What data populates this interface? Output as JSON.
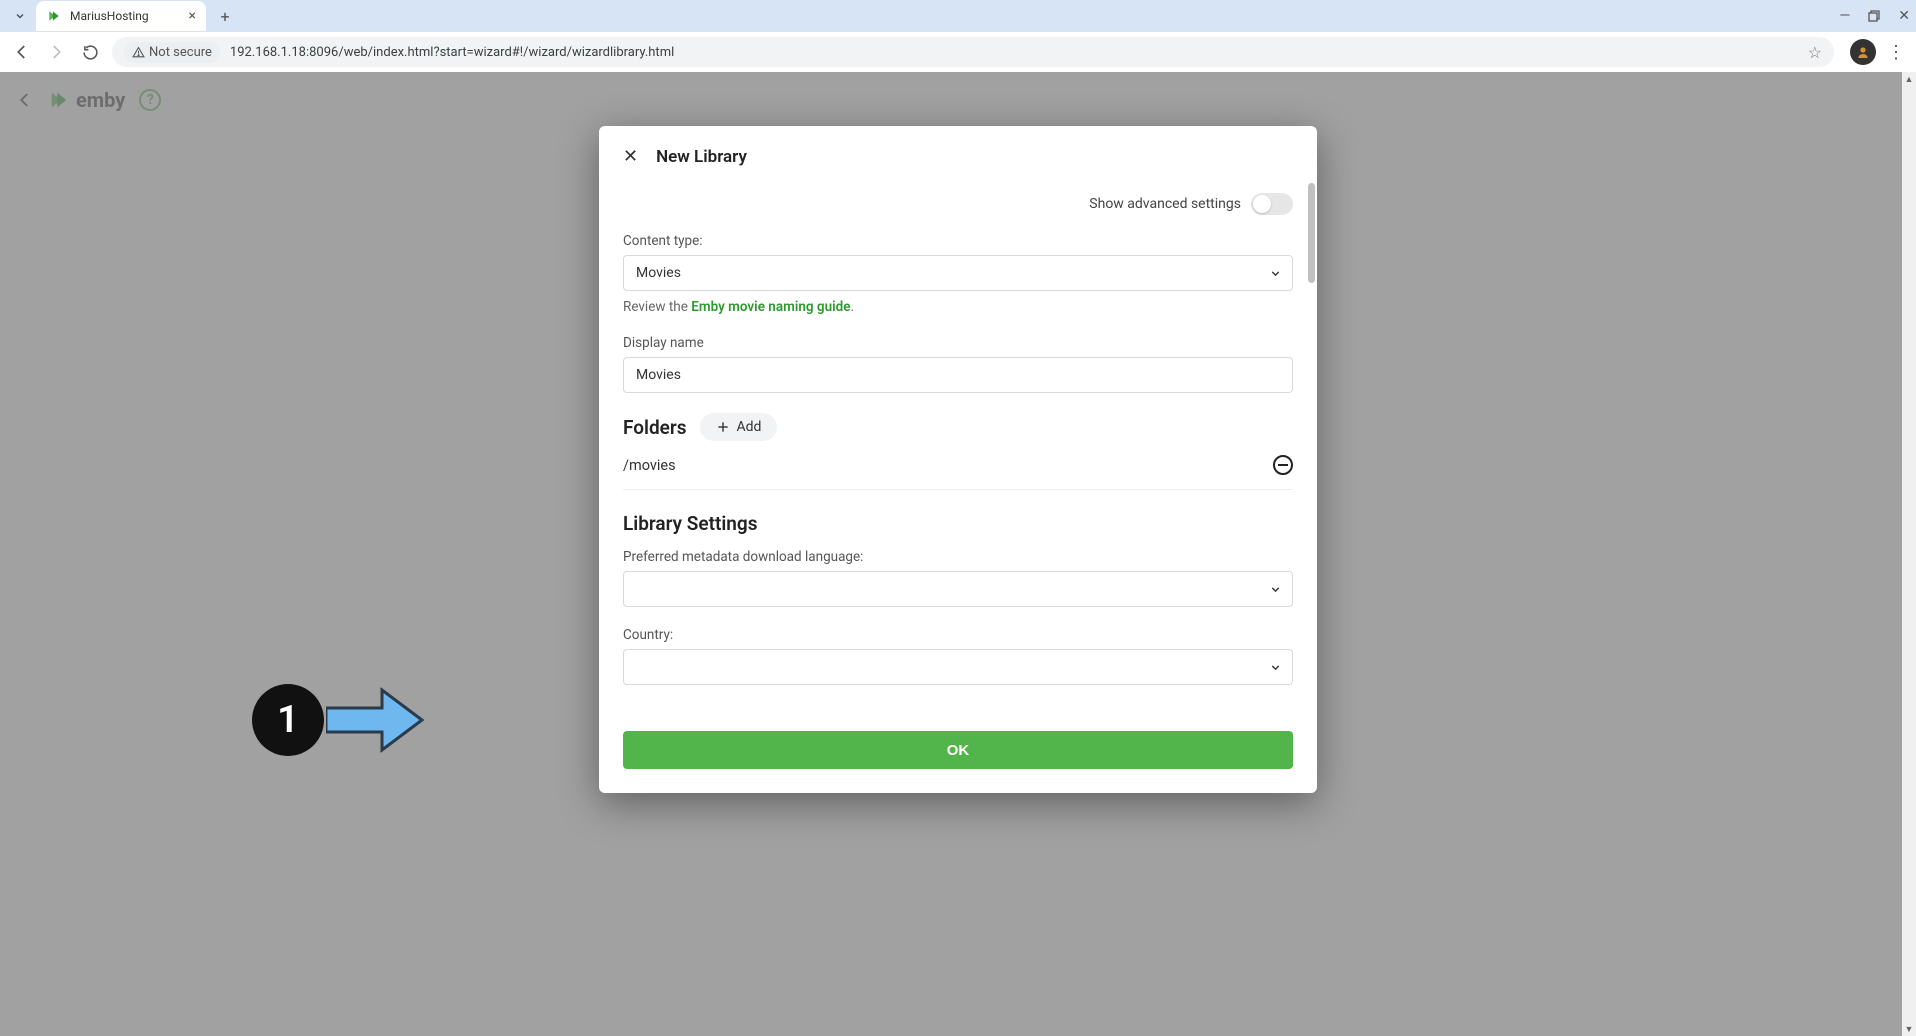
{
  "browser": {
    "tab_title": "MariusHosting",
    "not_secure_label": "Not secure",
    "url": "192.168.1.18:8096/web/index.html?start=wizard#!/wizard/wizardlibrary.html"
  },
  "app": {
    "brand": "emby"
  },
  "modal": {
    "title": "New Library",
    "advanced_label": "Show advanced settings",
    "content_type_label": "Content type:",
    "content_type_value": "Movies",
    "review_prefix": "Review the ",
    "review_link": "Emby movie naming guide",
    "review_suffix": ".",
    "display_name_label": "Display name",
    "display_name_value": "Movies",
    "folders_title": "Folders",
    "add_label": "Add",
    "folders": [
      {
        "path": "/movies"
      }
    ],
    "library_settings_title": "Library Settings",
    "metadata_lang_label": "Preferred metadata download language:",
    "metadata_lang_value": "",
    "country_label": "Country:",
    "country_value": "",
    "ok_label": "OK"
  },
  "annotation": {
    "badge": "1"
  }
}
